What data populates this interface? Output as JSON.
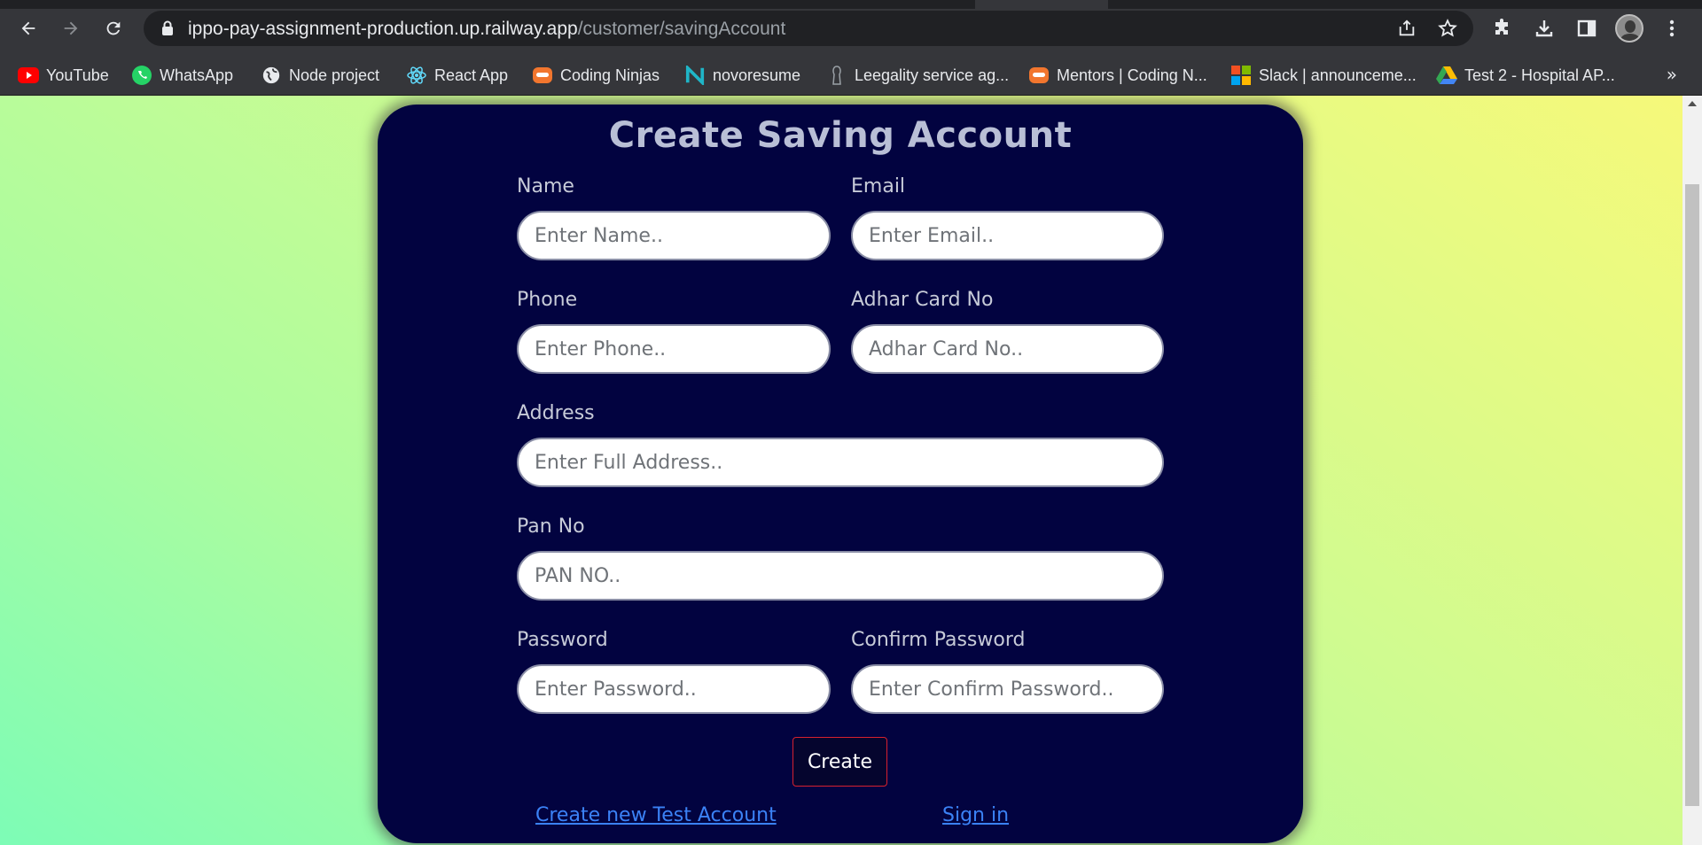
{
  "browser": {
    "url_host": "ippo-pay-assignment-production.up.railway.app",
    "url_path": "/customer/savingAccount"
  },
  "bookmarks": [
    {
      "label": "YouTube",
      "icon": "youtube-icon",
      "color": "#ff0000"
    },
    {
      "label": "WhatsApp",
      "icon": "whatsapp-icon",
      "color": "#25d366"
    },
    {
      "label": "Node project",
      "icon": "globe-icon",
      "color": "#e8eaed"
    },
    {
      "label": "React App",
      "icon": "react-icon",
      "color": "#61dafb"
    },
    {
      "label": "Coding Ninjas",
      "icon": "coding-ninjas-icon",
      "color": "#f2762e"
    },
    {
      "label": "novoresume",
      "icon": "novoresume-icon",
      "color": "#1fb5c7"
    },
    {
      "label": "Leegality service ag...",
      "icon": "leegality-icon",
      "color": "#9aa0a6"
    },
    {
      "label": "Mentors | Coding N...",
      "icon": "coding-ninjas-icon",
      "color": "#f2762e"
    },
    {
      "label": "Slack | announceme...",
      "icon": "microsoft-icon",
      "color": "#f25022"
    },
    {
      "label": "Test 2 - Hospital AP...",
      "icon": "google-drive-icon",
      "color": "#34a853"
    }
  ],
  "bookmarks_more": "»",
  "form": {
    "title": "Create Saving Account",
    "name_label": "Name",
    "name_placeholder": "Enter Name..",
    "email_label": "Email",
    "email_placeholder": "Enter Email..",
    "phone_label": "Phone",
    "phone_placeholder": "Enter Phone..",
    "adhar_label": "Adhar Card No",
    "adhar_placeholder": "Adhar Card No..",
    "address_label": "Address",
    "address_placeholder": "Enter Full Address..",
    "pan_label": "Pan No",
    "pan_placeholder": "PAN NO..",
    "password_label": "Password",
    "password_placeholder": "Enter Password..",
    "confirm_label": "Confirm Password",
    "confirm_placeholder": "Enter Confirm Password..",
    "create_label": "Create",
    "test_account_link": "Create new Test Account",
    "signin_link": "Sign in"
  },
  "colors": {
    "card_bg": "#020340",
    "link": "#3b82f6",
    "button_border": "#d6212f"
  }
}
